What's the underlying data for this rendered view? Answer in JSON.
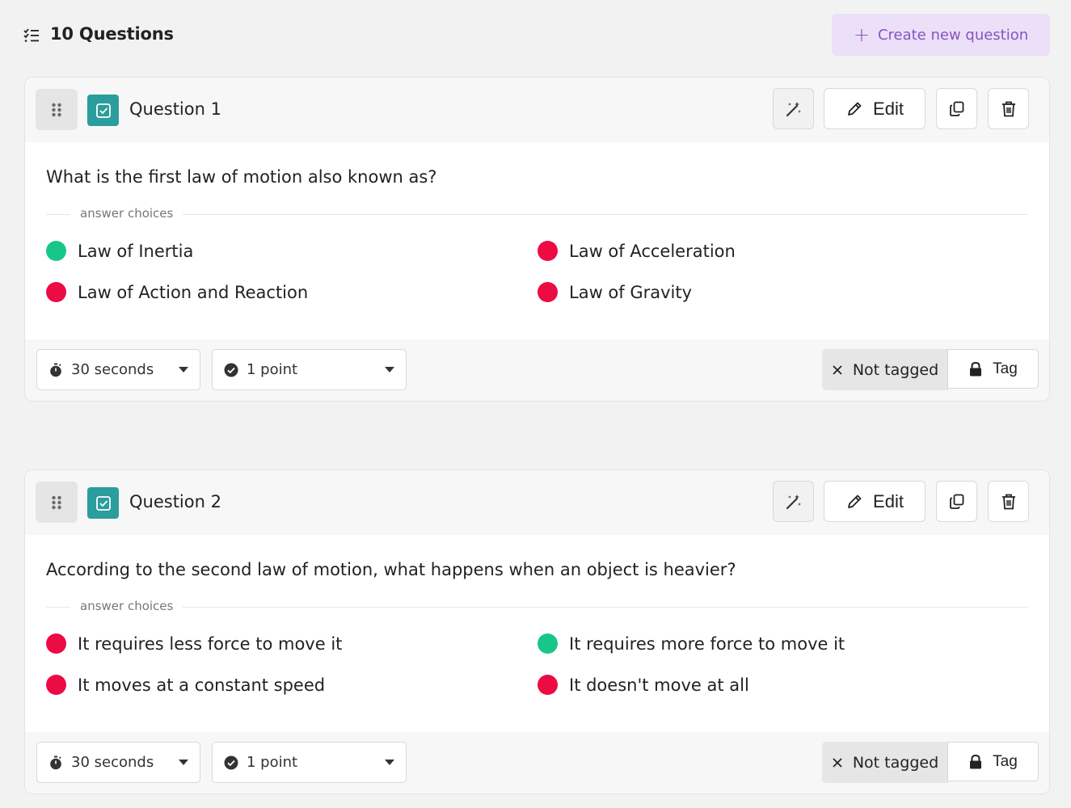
{
  "header": {
    "question_count": "10 Questions",
    "create_label": "Create new question",
    "create_color": "#8854c0"
  },
  "colors": {
    "correct": "#17c788",
    "incorrect": "#ec0b43",
    "question_type": "#2a9d9c"
  },
  "questions": [
    {
      "label": "Question 1",
      "text": "What is the first law of motion also known as?",
      "choices_label": "answer choices",
      "edit_label": "Edit",
      "choices": [
        {
          "text": "Law of Inertia",
          "correct": true
        },
        {
          "text": "Law of Acceleration",
          "correct": false
        },
        {
          "text": "Law of Action and Reaction",
          "correct": false
        },
        {
          "text": "Law of Gravity",
          "correct": false
        }
      ],
      "time": "30 seconds",
      "points": "1 point",
      "tag_status": "Not tagged",
      "tag_label": "Tag"
    },
    {
      "label": "Question 2",
      "text": "According to the second law of motion, what happens when an object is heavier?",
      "choices_label": "answer choices",
      "edit_label": "Edit",
      "choices": [
        {
          "text": "It requires less force to move it",
          "correct": false
        },
        {
          "text": "It requires more force to move it",
          "correct": true
        },
        {
          "text": "It moves at a constant speed",
          "correct": false
        },
        {
          "text": "It doesn't move at all",
          "correct": false
        }
      ],
      "time": "30 seconds",
      "points": "1 point",
      "tag_status": "Not tagged",
      "tag_label": "Tag"
    }
  ]
}
